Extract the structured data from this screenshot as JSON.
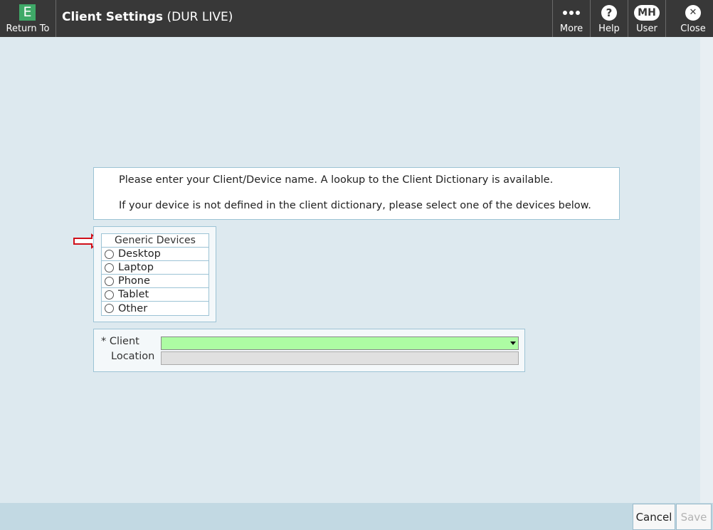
{
  "header": {
    "return_icon_letter": "E",
    "return_label": "Return To",
    "title": "Client Settings",
    "subtitle": "(DUR LIVE)",
    "more_label": "More",
    "help_icon_glyph": "?",
    "help_label": "Help",
    "user_initials": "MH",
    "user_label": "User",
    "close_icon_glyph": "✕",
    "close_label": "Close"
  },
  "info": {
    "line1": "Please enter your Client/Device name.  A lookup to the Client Dictionary is available.",
    "line2": "If your device is not defined in the client dictionary, please select one of the devices below."
  },
  "devices": {
    "header": "Generic Devices",
    "items": [
      "Desktop",
      "Laptop",
      "Phone",
      "Tablet",
      "Other"
    ]
  },
  "form": {
    "client_label": "* Client",
    "client_value": "",
    "location_label": "Location",
    "location_value": ""
  },
  "footer": {
    "cancel_label": "Cancel",
    "save_label": "Save"
  },
  "colors": {
    "header_bg": "#383838",
    "app_icon_green": "#3fa968",
    "required_field_green": "#adfca3",
    "arrow_red": "#d0101a",
    "panel_border": "#9cc3d5"
  }
}
